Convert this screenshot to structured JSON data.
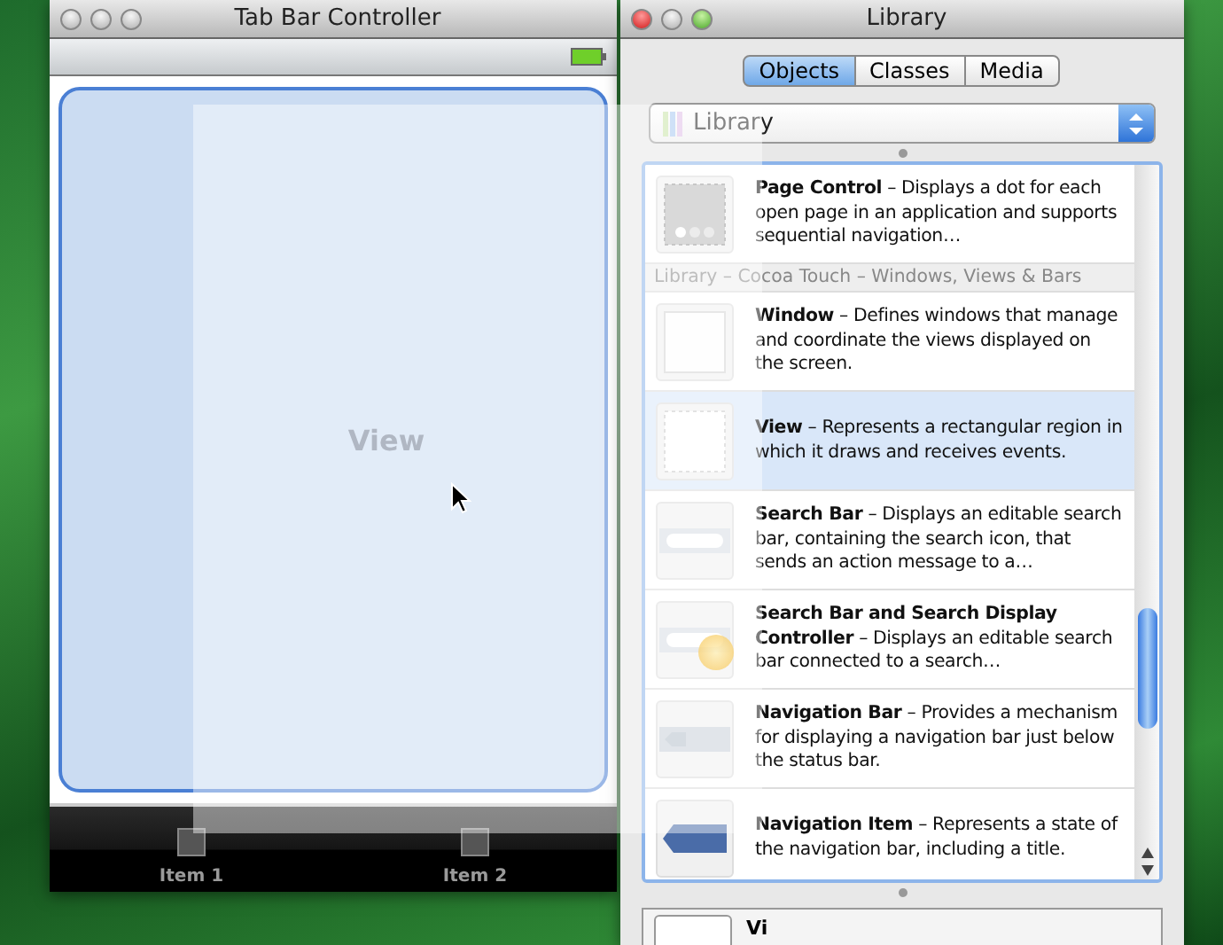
{
  "editor_window": {
    "title": "Tab Bar Controller",
    "view_label": "View",
    "tab_items": [
      {
        "label": "Item 1",
        "selected": false
      },
      {
        "label": "Item 2",
        "selected": false
      }
    ]
  },
  "library_window": {
    "title": "Library",
    "segments": [
      {
        "label": "Objects",
        "selected": true
      },
      {
        "label": "Classes",
        "selected": false
      },
      {
        "label": "Media",
        "selected": false
      }
    ],
    "popup": {
      "value": "Library"
    },
    "items": [
      {
        "kind": "pagecontrol",
        "name": "Page Control",
        "description": "– Displays a dot for each open page in an application and supports sequential navigation…",
        "selected": false
      },
      {
        "kind": "header",
        "text": "Library – Cocoa Touch – Windows, Views & Bars"
      },
      {
        "kind": "window",
        "name": "Window",
        "description": "– Defines windows that manage and coordinate the views displayed on the screen.",
        "selected": false
      },
      {
        "kind": "view",
        "name": "View",
        "description": "– Represents a rectangular region in which it draws and receives events.",
        "selected": true
      },
      {
        "kind": "searchbar",
        "name": "Search Bar",
        "description": "– Displays an editable search bar, containing the search icon, that sends an action message to a…",
        "selected": false
      },
      {
        "kind": "searchbar",
        "name": "Search Bar and Search Display Controller",
        "description": "– Displays an editable search bar connected to a search…",
        "selected": false
      },
      {
        "kind": "navbar",
        "name": "Navigation Bar",
        "description": "– Provides a mechanism for displaying a navigation bar just below the status bar.",
        "selected": false
      },
      {
        "kind": "navitem",
        "name": "Navigation Item",
        "description": "– Represents a state of the navigation bar, including a title.",
        "selected": false
      }
    ],
    "detail": {
      "name": "Vi"
    }
  }
}
